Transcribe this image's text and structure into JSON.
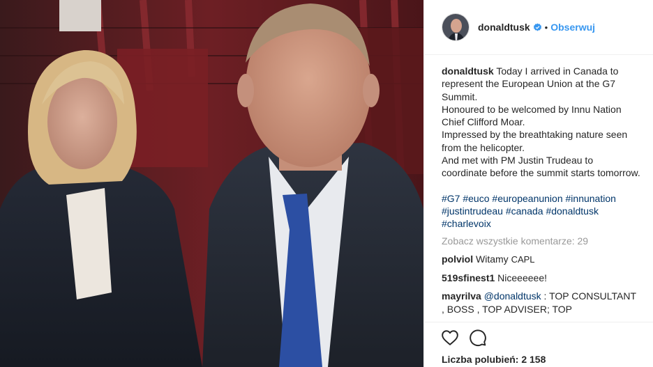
{
  "header": {
    "username": "donaldtusk",
    "separator": "•",
    "follow_label": "Obserwuj"
  },
  "caption": {
    "username": "donaldtusk",
    "lines": [
      "Today I arrived in Canada to represent the European Union at the G7 Summit.",
      "Honoured to be welcomed by Innu Nation Chief Clifford Moar.",
      "Impressed by the breathtaking nature seen from the helicopter.",
      "And met with PM Justin Trudeau to coordinate before the summit starts tomorrow."
    ],
    "hashtags": [
      "#G7",
      "#euco",
      "#europeanunion",
      "#innunation",
      "#justintrudeau",
      "#canada",
      "#donaldtusk",
      "#charlevoix"
    ]
  },
  "view_all_comments": "Zobacz wszystkie komentarze: 29",
  "comments": [
    {
      "username": "polviol",
      "text": "Witamy",
      "suffix": "CAPL"
    },
    {
      "username": "519sfinest1",
      "text": "Niceeeeee!"
    },
    {
      "username": "mayrilva",
      "mention": "@donaldtusk",
      "text": ": TOP CONSULTANT , BOSS , TOP ADVISER; TOP"
    }
  ],
  "actions": {
    "like_icon": "heart-outline-icon",
    "comment_icon": "speech-bubble-icon"
  },
  "likes_text": "Liczba polubień: 2 158",
  "colors": {
    "link": "#003569",
    "follow": "#3897f0",
    "muted": "#999999",
    "text": "#262626"
  }
}
